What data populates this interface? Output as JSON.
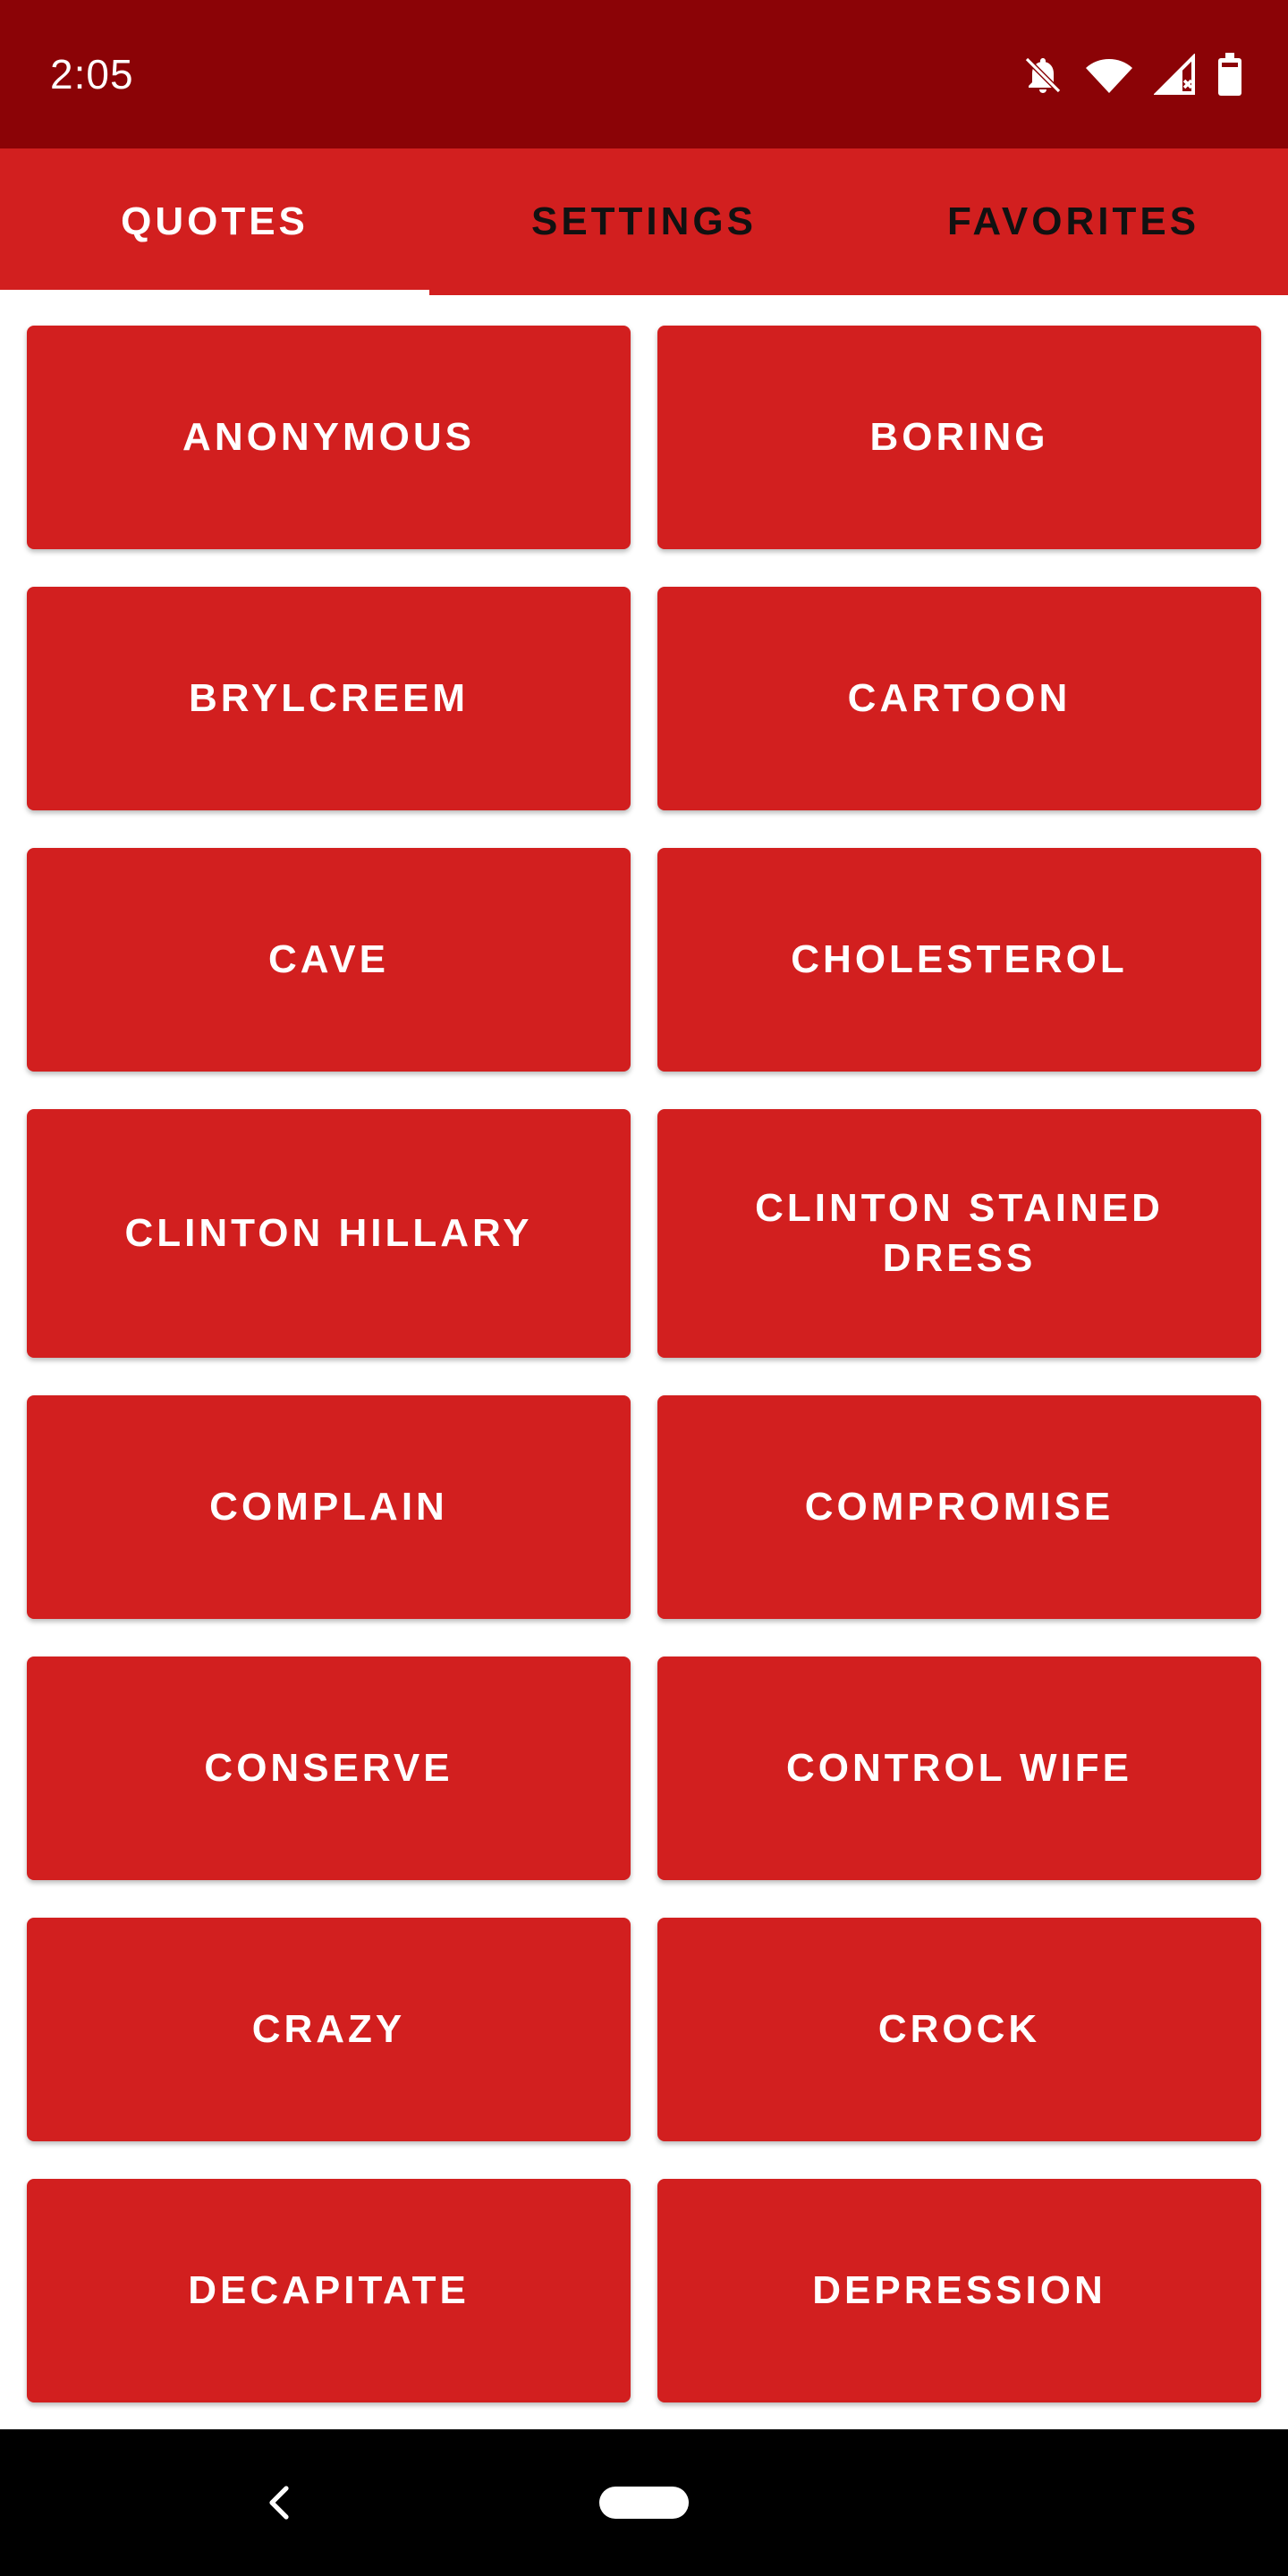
{
  "status_bar": {
    "time": "2:05",
    "icons": [
      "notifications-off-icon",
      "wifi-icon",
      "signal-icon",
      "battery-icon"
    ],
    "background": "#8b0306"
  },
  "tabs": [
    {
      "label": "QUOTES",
      "active": true
    },
    {
      "label": "SETTINGS",
      "active": false
    },
    {
      "label": "FAVORITES",
      "active": false
    }
  ],
  "quotes": [
    "ANONYMOUS",
    "BORING",
    "BRYLCREEM",
    "CARTOON",
    "CAVE",
    "CHOLESTEROL",
    "CLINTON HILLARY",
    "CLINTON STAINED DRESS",
    "COMPLAIN",
    "COMPROMISE",
    "CONSERVE",
    "CONTROL WIFE",
    "CRAZY",
    "CROCK",
    "DECAPITATE",
    "DEPRESSION"
  ],
  "colors": {
    "accent": "#d21f1f",
    "nav_bar": "#000000",
    "button_text": "#ffffff"
  },
  "nav_bar": {
    "icons": [
      "back-icon",
      "home-pill-icon"
    ]
  }
}
